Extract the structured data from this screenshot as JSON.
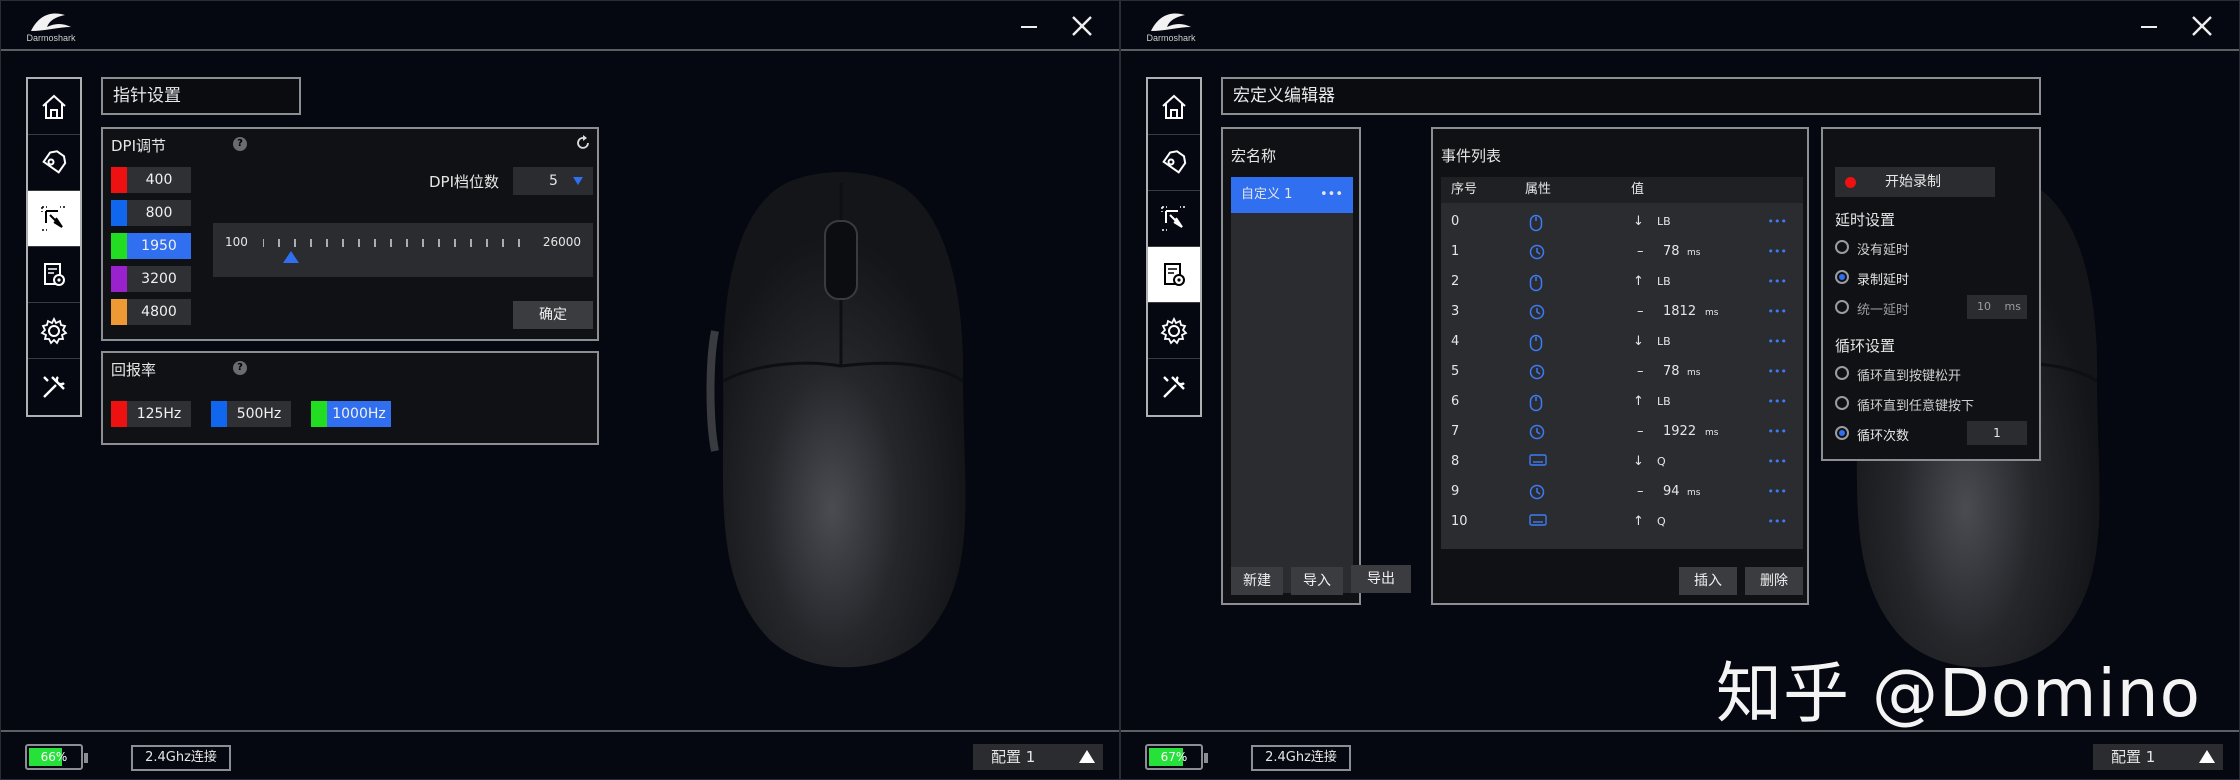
{
  "brand": {
    "logo_text": "Darmoshark"
  },
  "left": {
    "section_title": "指针设置",
    "dpi": {
      "title": "DPI调节",
      "help": "?",
      "stages_label": "DPI档位数",
      "stages_value": "5",
      "slider_min": "100",
      "slider_max": "26000",
      "slider_value": 1950,
      "confirm": "确定",
      "levels": [
        {
          "value": "400",
          "color": "#ee1111"
        },
        {
          "value": "800",
          "color": "#1166ee"
        },
        {
          "value": "1950",
          "color": "#22dd22",
          "selected": true
        },
        {
          "value": "3200",
          "color": "#9922cc"
        },
        {
          "value": "4800",
          "color": "#ee9933"
        }
      ]
    },
    "polling": {
      "title": "回报率",
      "help": "?",
      "rates": [
        {
          "value": "125Hz",
          "color": "#ee1111"
        },
        {
          "value": "500Hz",
          "color": "#1166ee"
        },
        {
          "value": "1000Hz",
          "color": "#22dd22",
          "selected": true
        }
      ]
    },
    "status": {
      "battery": "66%",
      "battery_level": 0.66,
      "connection": "2.4Ghz连接",
      "profile": "配置 1"
    }
  },
  "right": {
    "section_title": "宏定义编辑器",
    "macro_name_label": "宏名称",
    "macro_item": "自定义 1",
    "macro_buttons": {
      "new": "新建",
      "import": "导入",
      "export": "导出"
    },
    "events_label": "事件列表",
    "columns": {
      "index": "序号",
      "attr": "属性",
      "value": "值"
    },
    "events": [
      {
        "idx": "0",
        "type": "mouse",
        "dir": "↓",
        "val": "LB"
      },
      {
        "idx": "1",
        "type": "clock",
        "dir": "–",
        "val": "78",
        "unit": "ms"
      },
      {
        "idx": "2",
        "type": "mouse",
        "dir": "↑",
        "val": "LB"
      },
      {
        "idx": "3",
        "type": "clock",
        "dir": "–",
        "val": "1812",
        "unit": "ms"
      },
      {
        "idx": "4",
        "type": "mouse",
        "dir": "↓",
        "val": "LB"
      },
      {
        "idx": "5",
        "type": "clock",
        "dir": "–",
        "val": "78",
        "unit": "ms"
      },
      {
        "idx": "6",
        "type": "mouse",
        "dir": "↑",
        "val": "LB"
      },
      {
        "idx": "7",
        "type": "clock",
        "dir": "–",
        "val": "1922",
        "unit": "ms"
      },
      {
        "idx": "8",
        "type": "keyboard",
        "dir": "↓",
        "val": "Q"
      },
      {
        "idx": "9",
        "type": "clock",
        "dir": "–",
        "val": "94",
        "unit": "ms"
      },
      {
        "idx": "10",
        "type": "keyboard",
        "dir": "↑",
        "val": "Q"
      }
    ],
    "more": "•••",
    "event_buttons": {
      "insert": "插入",
      "delete": "删除"
    },
    "record": {
      "label": "开始录制",
      "dot_color": "#ee1111"
    },
    "delay": {
      "title": "延时设置",
      "options": [
        {
          "label": "没有延时",
          "on": false
        },
        {
          "label": "录制延时",
          "on": true
        },
        {
          "label": "统一延时",
          "on": false
        }
      ],
      "uniform_value": "10",
      "uniform_unit": "ms"
    },
    "loop": {
      "title": "循环设置",
      "options": [
        {
          "label": "循环直到按键松开",
          "on": false
        },
        {
          "label": "循环直到任意键按下",
          "on": false
        },
        {
          "label": "循环次数",
          "on": true
        }
      ],
      "count": "1"
    },
    "status": {
      "battery": "67%",
      "battery_level": 0.67,
      "connection": "2.4Ghz连接",
      "profile": "配置 1"
    }
  },
  "watermark": "知乎 @Domino"
}
